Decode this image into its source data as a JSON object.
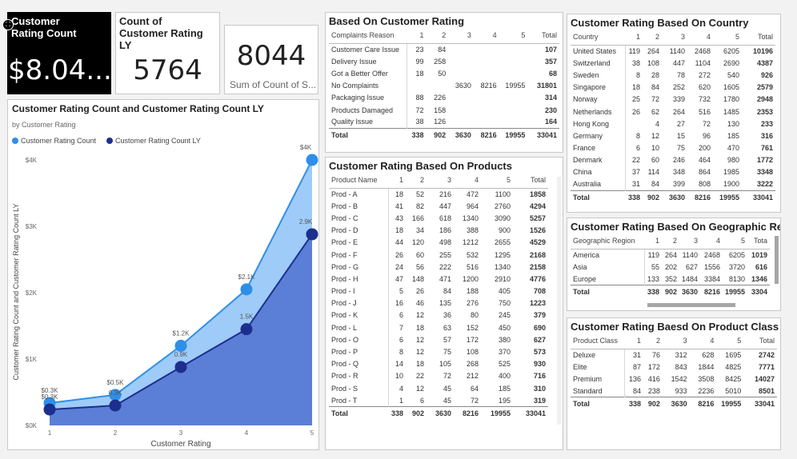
{
  "cards": {
    "rating_count": {
      "title": "Customer Rating Count",
      "value": "$8.04..."
    },
    "rating_count_ly": {
      "title": "Count of Customer Rating LY",
      "value": "5764"
    },
    "sum_count": {
      "value": "8044",
      "subtitle": "Sum of Count of S..."
    }
  },
  "colors": {
    "series1": "#2f8fe8",
    "series2": "#1d2f8e",
    "area1": "#9fcbf8",
    "area2": "#5b7fd6"
  },
  "chart": {
    "title": "Customer Rating Count and Customer Rating Count LY",
    "subtitle": "by Customer Rating",
    "legend": [
      "Customer Rating Count",
      "Customer Rating Count LY"
    ],
    "xlabel": "Customer Rating",
    "ylabel": "Customer Rating Count and Customer Rating Count LY",
    "yticks": [
      "$0K",
      "$1K",
      "$2K",
      "$3K",
      "$4K"
    ]
  },
  "chart_data": {
    "type": "area",
    "title": "Customer Rating Count and Customer Rating Count LY",
    "subtitle": "by Customer Rating",
    "xlabel": "Customer Rating",
    "ylabel": "Customer Rating Count and Customer Rating Count LY",
    "x": [
      1,
      2,
      3,
      4,
      5
    ],
    "ylim": [
      0,
      4000
    ],
    "series": [
      {
        "name": "Customer Rating Count",
        "values": [
          338,
          460,
          1200,
          2050,
          4000
        ],
        "labels": [
          "$0.3K",
          "$0.5K",
          "$1.2K",
          "$2.1K",
          "$4K"
        ]
      },
      {
        "name": "Customer Rating Count LY",
        "values": [
          240,
          300,
          880,
          1450,
          2880
        ],
        "labels": [
          "$0.3K",
          "0.3K",
          "0.9K",
          "1.5K",
          "2.9K"
        ]
      }
    ],
    "legend_position": "top-left",
    "grid": false
  },
  "complaints": {
    "title": "Based On Customer Rating",
    "headers": [
      "Complaints Reason",
      "1",
      "2",
      "3",
      "4",
      "5",
      "Total"
    ],
    "rows": [
      [
        "Customer Care Issue",
        "23",
        "84",
        "",
        "",
        "",
        "107"
      ],
      [
        "Delivery Issue",
        "99",
        "258",
        "",
        "",
        "",
        "357"
      ],
      [
        "Got a Better Offer",
        "18",
        "50",
        "",
        "",
        "",
        "68"
      ],
      [
        "No Complaints",
        "",
        "",
        "3630",
        "8216",
        "19955",
        "31801"
      ],
      [
        "Packaging Issue",
        "88",
        "226",
        "",
        "",
        "",
        "314"
      ],
      [
        "Products Damaged",
        "72",
        "158",
        "",
        "",
        "",
        "230"
      ],
      [
        "Quality Issue",
        "38",
        "126",
        "",
        "",
        "",
        "164"
      ]
    ],
    "total": [
      "Total",
      "338",
      "902",
      "3630",
      "8216",
      "19955",
      "33041"
    ]
  },
  "products": {
    "title": "Customer Rating Based On Products",
    "headers": [
      "Product Name",
      "1",
      "2",
      "3",
      "4",
      "5",
      "Total"
    ],
    "rows": [
      [
        "Prod - A",
        "18",
        "52",
        "216",
        "472",
        "1100",
        "1858"
      ],
      [
        "Prod - B",
        "41",
        "82",
        "447",
        "964",
        "2760",
        "4294"
      ],
      [
        "Prod - C",
        "43",
        "166",
        "618",
        "1340",
        "3090",
        "5257"
      ],
      [
        "Prod - D",
        "18",
        "34",
        "186",
        "388",
        "900",
        "1526"
      ],
      [
        "Prod - E",
        "44",
        "120",
        "498",
        "1212",
        "2655",
        "4529"
      ],
      [
        "Prod - F",
        "26",
        "60",
        "255",
        "532",
        "1295",
        "2168"
      ],
      [
        "Prod - G",
        "24",
        "56",
        "222",
        "516",
        "1340",
        "2158"
      ],
      [
        "Prod - H",
        "47",
        "148",
        "471",
        "1200",
        "2910",
        "4776"
      ],
      [
        "Prod - I",
        "5",
        "26",
        "84",
        "188",
        "405",
        "708"
      ],
      [
        "Prod - J",
        "16",
        "46",
        "135",
        "276",
        "750",
        "1223"
      ],
      [
        "Prod - K",
        "6",
        "12",
        "36",
        "80",
        "245",
        "379"
      ],
      [
        "Prod - L",
        "7",
        "18",
        "63",
        "152",
        "450",
        "690"
      ],
      [
        "Prod - O",
        "6",
        "12",
        "57",
        "172",
        "380",
        "627"
      ],
      [
        "Prod - P",
        "8",
        "12",
        "75",
        "108",
        "370",
        "573"
      ],
      [
        "Prod - Q",
        "14",
        "18",
        "105",
        "268",
        "525",
        "930"
      ],
      [
        "Prod - R",
        "10",
        "22",
        "72",
        "212",
        "400",
        "716"
      ],
      [
        "Prod - S",
        "4",
        "12",
        "45",
        "64",
        "185",
        "310"
      ],
      [
        "Prod - T",
        "1",
        "6",
        "45",
        "72",
        "195",
        "319"
      ]
    ],
    "total": [
      "Total",
      "338",
      "902",
      "3630",
      "8216",
      "19955",
      "33041"
    ]
  },
  "country": {
    "title": "Customer Rating Based On Country",
    "headers": [
      "Country",
      "1",
      "2",
      "3",
      "4",
      "5",
      "Total"
    ],
    "rows": [
      [
        "United States",
        "119",
        "264",
        "1140",
        "2468",
        "6205",
        "10196"
      ],
      [
        "Switzerland",
        "38",
        "108",
        "447",
        "1104",
        "2690",
        "4387"
      ],
      [
        "Sweden",
        "8",
        "28",
        "78",
        "272",
        "540",
        "926"
      ],
      [
        "Singapore",
        "18",
        "84",
        "252",
        "620",
        "1605",
        "2579"
      ],
      [
        "Norway",
        "25",
        "72",
        "339",
        "732",
        "1780",
        "2948"
      ],
      [
        "Netherlands",
        "26",
        "62",
        "264",
        "516",
        "1485",
        "2353"
      ],
      [
        "Hong Kong",
        "",
        "4",
        "27",
        "72",
        "130",
        "233"
      ],
      [
        "Germany",
        "8",
        "12",
        "15",
        "96",
        "185",
        "316"
      ],
      [
        "France",
        "6",
        "10",
        "75",
        "200",
        "470",
        "761"
      ],
      [
        "Denmark",
        "22",
        "60",
        "246",
        "464",
        "980",
        "1772"
      ],
      [
        "China",
        "37",
        "114",
        "348",
        "864",
        "1985",
        "3348"
      ],
      [
        "Australia",
        "31",
        "84",
        "399",
        "808",
        "1900",
        "3222"
      ]
    ],
    "total": [
      "Total",
      "338",
      "902",
      "3630",
      "8216",
      "19955",
      "33041"
    ]
  },
  "region": {
    "title": "Customer Rating Based On Geographic Region",
    "headers": [
      "Geographic Region",
      "1",
      "2",
      "3",
      "4",
      "5",
      "Tota"
    ],
    "rows": [
      [
        "America",
        "119",
        "264",
        "1140",
        "2468",
        "6205",
        "1019"
      ],
      [
        "Asia",
        "55",
        "202",
        "627",
        "1556",
        "3720",
        "616"
      ],
      [
        "Europe",
        "133",
        "352",
        "1484",
        "3384",
        "8130",
        "1346"
      ]
    ],
    "total": [
      "Total",
      "338",
      "902",
      "3630",
      "8216",
      "19955",
      "3304"
    ]
  },
  "product_class": {
    "title": "Customer Rating Baesd On Product Class",
    "headers": [
      "Product Class",
      "1",
      "2",
      "3",
      "4",
      "5",
      "Total"
    ],
    "rows": [
      [
        "Deluxe",
        "31",
        "76",
        "312",
        "628",
        "1695",
        "2742"
      ],
      [
        "Elite",
        "87",
        "172",
        "843",
        "1844",
        "4825",
        "7771"
      ],
      [
        "Premium",
        "136",
        "416",
        "1542",
        "3508",
        "8425",
        "14027"
      ],
      [
        "Standard",
        "84",
        "238",
        "933",
        "2236",
        "5010",
        "8501"
      ]
    ],
    "total": [
      "Total",
      "338",
      "902",
      "3630",
      "8216",
      "19955",
      "33041"
    ]
  }
}
